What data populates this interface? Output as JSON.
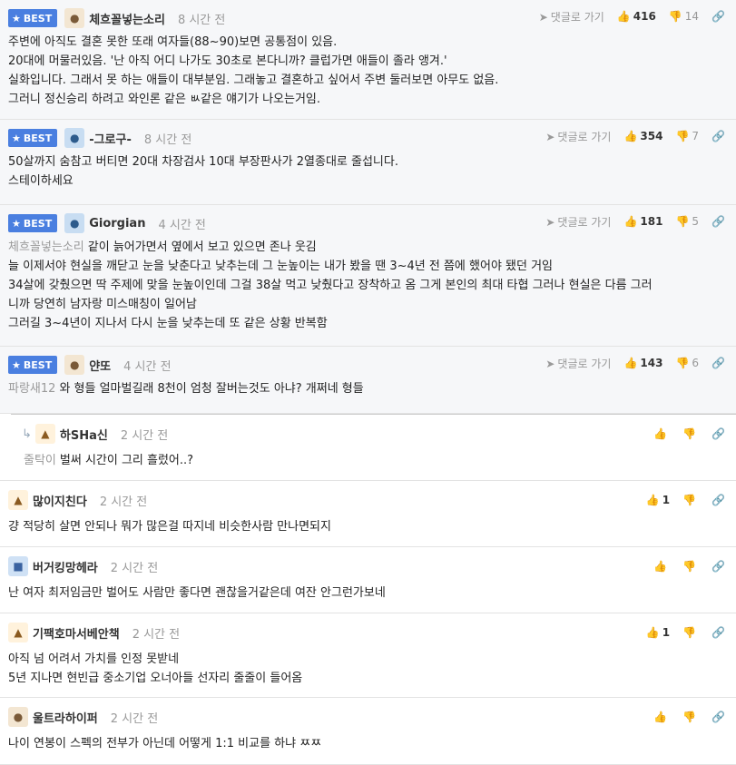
{
  "labels": {
    "best": "BEST",
    "goto_reply": "댓글로 가기"
  },
  "colors": {
    "best_badge": "#4a7fe0",
    "best_bg": "#f6f7f9",
    "mention": "#999999"
  },
  "icons": {
    "best": "star-icon",
    "goto": "send-arrow-icon",
    "like": "thumbs-up-icon",
    "dislike": "thumbs-down-icon",
    "link": "link-icon",
    "reply": "reply-arrow-icon"
  },
  "comments": [
    {
      "nick": "체흐꼴넣는소리",
      "time": "8 시간 전",
      "likes": "416",
      "dislikes": "14",
      "lines": [
        "주변에 아직도 결혼 못한 또래 여자들(88~90)보면 공통점이 있음.",
        "20대에 머물러있음. '난 아직 어디 나가도 30초로 본다니까? 클럽가면 애들이 졸라 앵겨.'",
        "실화입니다. 그래서 못 하는 애들이 대부분임. 그래놓고 결혼하고 싶어서 주변 둘러보면 아무도 없음.",
        "그러니 정신승리 하려고 와인론 같은 ㅄ같은 얘기가 나오는거임."
      ]
    },
    {
      "nick": "-그로구-",
      "time": "8 시간 전",
      "likes": "354",
      "dislikes": "7",
      "lines": [
        "50살까지 숨참고 버티면 20대 차장검사 10대 부장판사가 2열종대로 줄섭니다.",
        "스테이하세요"
      ]
    },
    {
      "nick": "Giorgian",
      "time": "4 시간 전",
      "likes": "181",
      "dislikes": "5",
      "mention": "체흐꼴넣는소리",
      "first": "같이 늙어가면서 옆에서 보고 있으면 존나 웃김",
      "lines": [
        "늘 이제서야 현실을 깨닫고 눈을 낮춘다고 낮추는데 그 눈높이는 내가 봤을 땐 3~4년 전 쯤에 했어야 됐던 거임",
        "34살에 갖췄으면 딱 주제에 맞을 눈높이인데 그걸 38살 먹고 낮췄다고 장착하고 옴 그게 본인의 최대 타협 그러나 현실은 다름 그러",
        "니까 당연히 남자랑 미스매칭이 일어남",
        "그러길 3~4년이 지나서 다시 눈을 낮추는데 또 같은 상황 반복함"
      ]
    },
    {
      "nick": "얀또",
      "time": "4 시간 전",
      "likes": "143",
      "dislikes": "6",
      "mention": "파랑새12",
      "first": "와 형들 얼마벌길래 8천이 엄청 잘버는것도 아냐? 개쩌네 형들"
    },
    {
      "nick": "하SHa신",
      "time": "2 시간 전",
      "mention": "줄탁이",
      "first": "벌써 시간이 그리 흘렀어..?"
    },
    {
      "nick": "많이지친다",
      "time": "2 시간 전",
      "likes": "1",
      "lines": [
        "걍 적당히 살면 안되나 뭐가 많은걸 따지네 비슷한사람 만나면되지"
      ]
    },
    {
      "nick": "버거킹망헤라",
      "time": "2 시간 전",
      "lines": [
        "난 여자 최저임금만 벌어도 사람만 좋다면 괜찮을거같은데 여잔 안그런가보네"
      ]
    },
    {
      "nick": "기팩호마서베안책",
      "time": "2 시간 전",
      "likes": "1",
      "lines": [
        "아직 넘 어려서 가치를 인정 못받네",
        "5년 지나면 현빈급 중소기업 오너아들 선자리 줄줄이 들어옴"
      ]
    },
    {
      "nick": "울트라하이퍼",
      "time": "2 시간 전",
      "lines": [
        "나이 연봉이 스펙의 전부가 아닌데 어떻게 1:1 비교를 하냐 ㅉㅉ"
      ]
    }
  ]
}
